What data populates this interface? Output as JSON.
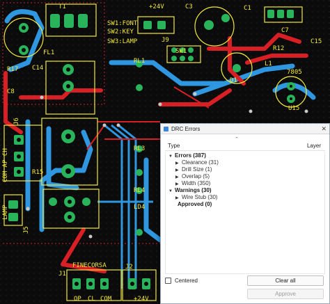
{
  "board": {
    "colors": {
      "background": "#0b0b0b",
      "top_copper": "#d81f26",
      "bottom_copper": "#2f96e0",
      "silkscreen": "#f2e93c",
      "pad": "#29b35a",
      "pad_hole": "#0b0b0b",
      "via": "#c8c8c8"
    },
    "labels": {
      "t1": "T1",
      "j2_top": "+24V",
      "c3": "C3",
      "c1": "C1",
      "c7": "C7",
      "c15": "C15",
      "sw1": "SW1:FONT",
      "sw2": "SW2:KEY",
      "sw3": "SW3:LAMP",
      "j9": "J9",
      "r12": "R12",
      "l1": "L1",
      "r17": "R17",
      "c14": "C14",
      "fl1": "FL1",
      "c8": "C8",
      "sw": "SW1",
      "rl1": "RL1",
      "rl3": "RL3",
      "rl4": "RL4",
      "j6": "J6",
      "j5": "J5",
      "lamp": "LAMP",
      "ld4": "LD4",
      "u15": "U15",
      "fine_corsa": "FINECORSA",
      "j1": "J1",
      "j2": "J2",
      "op": "OP",
      "cl": "CL",
      "com": "COM",
      "plus24": "+24V",
      "com_ap_ch": "COM AP CH",
      "d1": "D1",
      "r15": "R15",
      "t805": "7805"
    }
  },
  "drc": {
    "title": "DRC Errors",
    "columns": {
      "type": "Type",
      "layer": "Layer"
    },
    "tree": [
      {
        "label": "Errors (387)",
        "children": [
          "Clearance (31)",
          "Drill Size (1)",
          "Overlap (5)",
          "Width (350)"
        ]
      },
      {
        "label": "Warnings (30)",
        "children": [
          "Wire Stub (30)"
        ]
      },
      {
        "label": "Approved (0)",
        "children": []
      }
    ],
    "centered_label": "Centered",
    "clear_all_label": "Clear all",
    "approve_label": "Approve"
  }
}
